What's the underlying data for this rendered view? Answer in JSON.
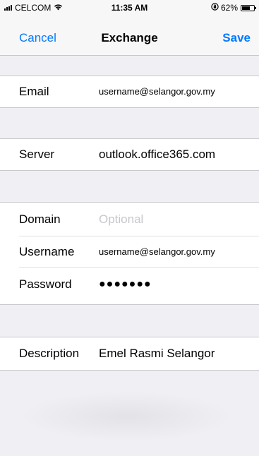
{
  "status_bar": {
    "carrier": "CELCOM",
    "time": "11:35 AM",
    "battery": "62%",
    "battery_level": 0.62,
    "icons": [
      "signal-icon",
      "wifi-icon",
      "rotation-lock-icon",
      "battery-icon"
    ]
  },
  "nav": {
    "cancel_label": "Cancel",
    "title": "Exchange",
    "save_label": "Save",
    "accent_color": "#007aff"
  },
  "fields": {
    "email": {
      "label": "Email",
      "value": "username@selangor.gov.my"
    },
    "server": {
      "label": "Server",
      "value": "outlook.office365.com"
    },
    "domain": {
      "label": "Domain",
      "placeholder": "Optional"
    },
    "username": {
      "label": "Username",
      "value": "username@selangor.gov.my"
    },
    "password": {
      "label": "Password",
      "value": "●●●●●●●"
    },
    "description": {
      "label": "Description",
      "value": "Emel Rasmi Selangor"
    }
  }
}
